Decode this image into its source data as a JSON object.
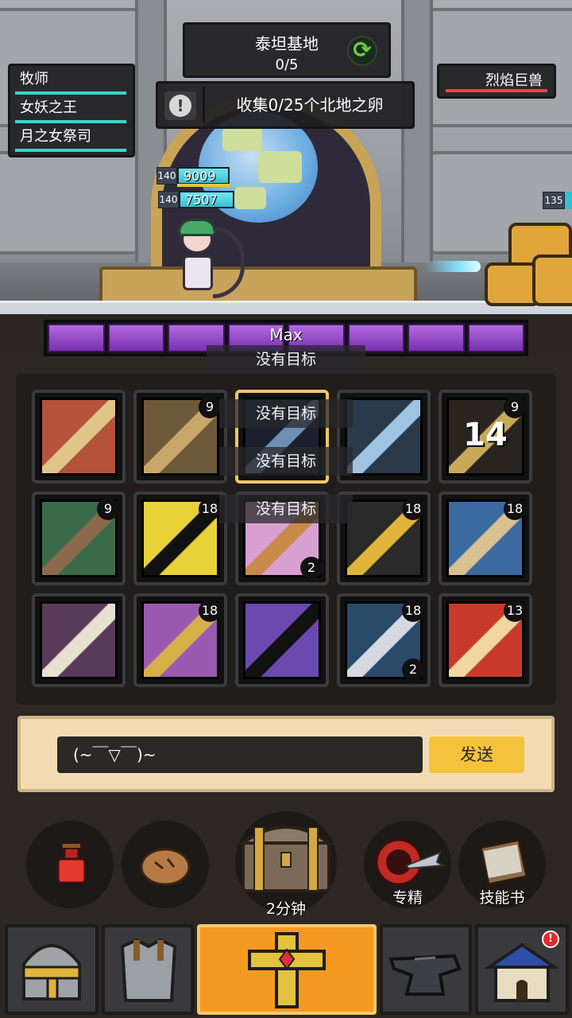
{
  "hud": {
    "base_name": "泰坦基地",
    "base_progress": "0/5",
    "quest_text": "收集0/25个北地之卵",
    "alert_glyph": "!"
  },
  "party": [
    {
      "name": "牧师"
    },
    {
      "name": "女妖之王"
    },
    {
      "name": "月之女祭司"
    }
  ],
  "boss": {
    "name": "烈焰巨兽"
  },
  "hero_stats": {
    "level_a": "140",
    "value_a": "9009",
    "level_b": "140",
    "value_b": "7507"
  },
  "enemy_stats": {
    "level": "135"
  },
  "rage_bar": {
    "label": "Max",
    "segments": 8
  },
  "no_target_text": "没有目标",
  "skills": [
    {
      "icon": "fire-slash-icon",
      "badge": ""
    },
    {
      "icon": "fist-strike-icon",
      "badge": "9"
    },
    {
      "icon": "shield-gear-icon",
      "badge": "",
      "selected": true
    },
    {
      "icon": "frost-rune-icon",
      "badge": ""
    },
    {
      "icon": "timer-crystal-icon",
      "badge": "9",
      "big": "14"
    },
    {
      "icon": "root-tangle-icon",
      "badge": "9"
    },
    {
      "icon": "poison-skull-icon",
      "badge": "18"
    },
    {
      "icon": "spiral-scroll-icon",
      "badge": "",
      "badge_bottom": "2"
    },
    {
      "icon": "fire-skull-icon",
      "badge": "18"
    },
    {
      "icon": "water-stream-icon",
      "badge": "18"
    },
    {
      "icon": "grin-teeth-icon",
      "badge": ""
    },
    {
      "icon": "shadow-dagger-icon",
      "badge": "18"
    },
    {
      "icon": "void-swirl-icon",
      "badge": ""
    },
    {
      "icon": "bone-hand-icon",
      "badge": "18",
      "badge_bottom": "2"
    },
    {
      "icon": "hammer-burst-icon",
      "badge": "13"
    }
  ],
  "chat": {
    "input_value": "(~￣▽￣)~",
    "send_label": "发送"
  },
  "actions": {
    "chest_timer": "2分钟",
    "specialization_label": "专精",
    "skillbook_label": "技能书"
  },
  "nav": {
    "notification": "!"
  },
  "colors": {
    "hp_party": "#35d8c5",
    "hp_boss": "#e44a3a",
    "rage": "#8f3fc4",
    "send_button": "#f4c33b",
    "chat_bg": "#f3dcb4",
    "nav_active": "#f59a20"
  }
}
